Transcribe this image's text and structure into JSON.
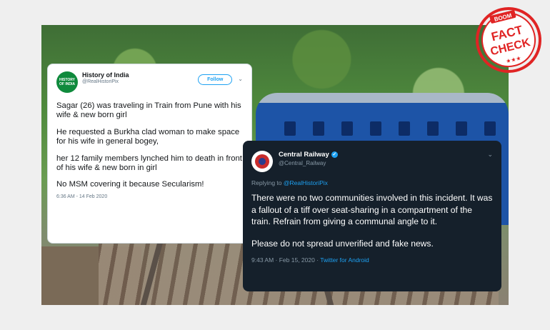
{
  "tweet1": {
    "avatar_text": "HISTORY OF INDIA",
    "name": "History of India",
    "handle": "@RealHistoriPix",
    "follow_label": "Follow",
    "paragraphs": [
      "Sagar (26) was traveling in Train from Pune with his wife & new born girl",
      "He requested a Burkha clad woman to make space for his wife in general bogey,",
      "her 12 family members lynched him to death in front of his wife & new born in girl",
      "No MSM covering it because Secularism!"
    ],
    "timestamp": "6:36 AM - 14 Feb 2020",
    "chevron_icon": "chevron-down-icon"
  },
  "tweet2": {
    "name": "Central Railway",
    "handle": "@Central_Railway",
    "replying_prefix": "Replying to ",
    "replying_to": "@RealHistoriPix",
    "paragraphs": [
      "There were no two communities involved in this incident. It was a fallout of a tiff over seat-sharing in a compartment of the train.  Refrain from giving a communal angle to it.",
      "Please do not spread unverified and fake news."
    ],
    "time": "9:43 AM · Feb 15, 2020 · ",
    "source": "Twitter for Android",
    "verified_icon": "verified-badge-icon",
    "chevron_icon": "chevron-down-icon"
  },
  "stamp": {
    "brand": "BOOM",
    "line1": "FACT",
    "line2": "CHECK",
    "stars": "★★★",
    "color": "#e02424"
  }
}
